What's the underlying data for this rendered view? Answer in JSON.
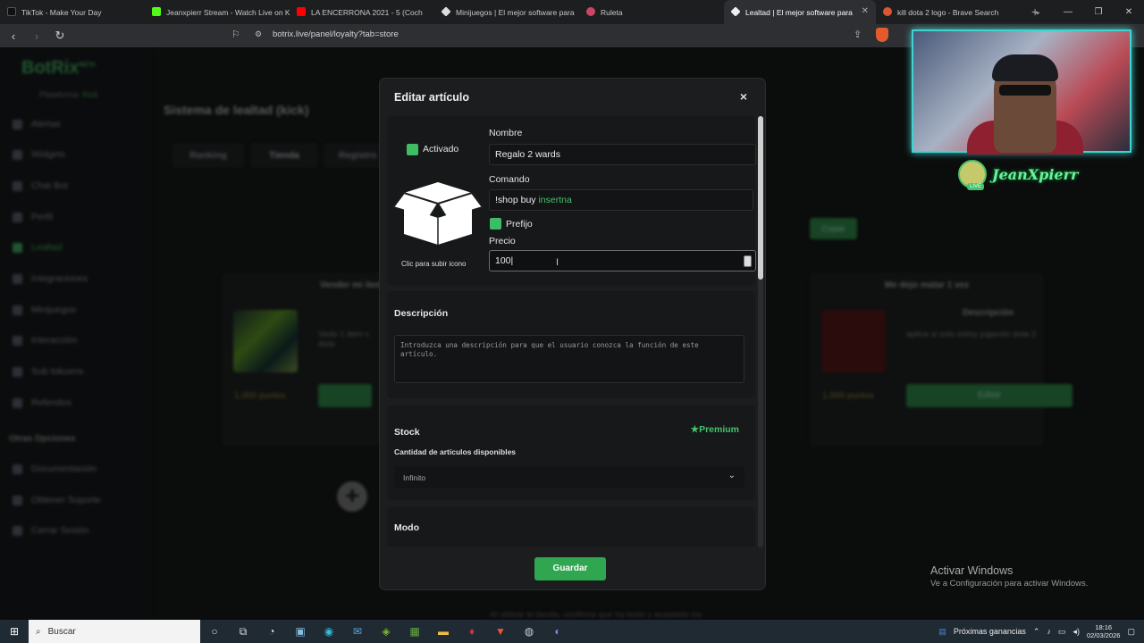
{
  "browser": {
    "tabs": [
      {
        "label": "TikTok - Make Your Day",
        "color": "#111111"
      },
      {
        "label": "Jeanxpierr Stream - Watch Live on Ki",
        "color": "#53fc18"
      },
      {
        "label": "LA ENCERRONA 2021 - 5 (Coch",
        "color": "#ff0000"
      },
      {
        "label": "Minijuegos | El mejor software para",
        "color": "#eeeeee"
      },
      {
        "label": "Ruleta",
        "color": "#cc4466"
      },
      {
        "label": "Lealtad | El mejor software para",
        "color": "#eeeeee",
        "active": true
      },
      {
        "label": "kill dota 2 logo - Brave Search",
        "color": "#dd5533"
      }
    ],
    "url": "botrix.live/panel/loyalty?tab=store"
  },
  "sidebar": {
    "logo": "BotRix",
    "logo_badge": "BETA",
    "platform_label": "Plataforma:",
    "platform_value": "Kick",
    "items": [
      "Alertas",
      "Widgets",
      "Chat Bot",
      "Perfil",
      "Lealtad",
      "Integraciones",
      "Minijuegos",
      "Interacción",
      "Sub tokuens",
      "Referidos"
    ],
    "section": "Otras Opciones",
    "other_items": [
      "Documentación",
      "Obtener Soporte",
      "Cerrar Sesión"
    ]
  },
  "main": {
    "title": "Sistema de lealtad (kick)",
    "tabs": [
      "Ranking",
      "Tienda",
      "Registro"
    ],
    "copy_button": "Copiar",
    "cards": [
      {
        "title": "Vender mi item",
        "desc": "Vedo 1 item c dota",
        "points": "1,000 puntos"
      },
      {
        "title": "Me dejo matar 1 vez",
        "desc_header": "Descripción",
        "desc": "aplica si solo estoy jugando dota 2",
        "points": "1,000 puntos",
        "button": "Editar"
      }
    ],
    "bottom_note": "Al utilizar la tienda, confirma que ha leído y aceptado los"
  },
  "modal": {
    "title": "Editar artículo",
    "close": "×",
    "activated_label": "Activado",
    "upload_label": "Clic para subir icono",
    "name_label": "Nombre",
    "name_value": "Regalo 2 wards",
    "command_label": "Comando",
    "command_prefix": "!shop buy",
    "command_placeholder": "insertna",
    "prefix_label": "Prefijo",
    "price_label": "Precio",
    "price_value": "100",
    "description_label": "Descripción",
    "description_placeholder": "Introduzca una descripción para que el usuario conozca la función de este artículo.",
    "stock_label": "Stock",
    "premium_label": "Premium",
    "stock_sub_label": "Cantidad de artículos disponibles",
    "stock_value": "Infinito",
    "mode_label": "Modo",
    "save_button": "Guardar",
    "accent": "#3fbd62"
  },
  "overlay": {
    "streamer_name": "JeanXpierr",
    "live_badge": "LIVE",
    "watermark_title": "Activar Windows",
    "watermark_sub": "Ve a Configuración para activar Windows."
  },
  "taskbar": {
    "search_placeholder": "Buscar",
    "news": "Próximas ganancias",
    "time": "18:16",
    "date": "02/03/2026"
  }
}
